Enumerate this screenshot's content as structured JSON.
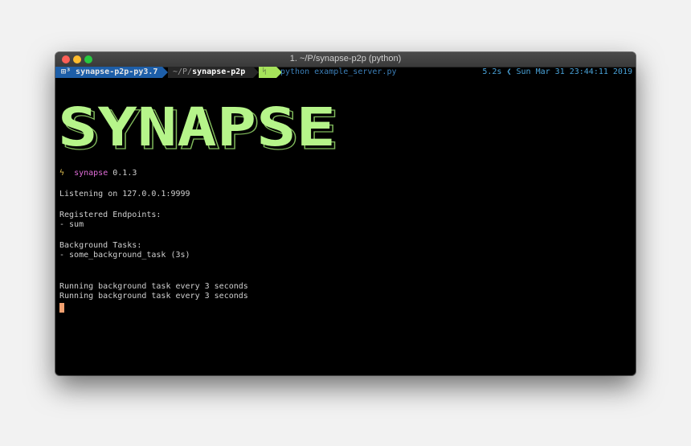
{
  "window": {
    "title": "1. ~/P/synapse-p2p (python)"
  },
  "prompt": {
    "env": "⊞³ synapse-p2p-py3.7",
    "dir_prefix": "~/P/",
    "dir_name": "synapse-p2p",
    "git_icon": "ᛋ",
    "command": "python example_server.py",
    "right": "5.2s ❮ Sun Mar 31 23:44:11 2019"
  },
  "banner": {
    "text": "SYNAPSE"
  },
  "output": {
    "bolt": "ϟ",
    "package_name": "synapse",
    "version": "0.1.3",
    "listening": "Listening on 127.0.0.1:9999",
    "endpoints_header": "Registered Endpoints:",
    "endpoint_1": "- sum",
    "tasks_header": "Background Tasks:",
    "task_1": "- some_background_task (3s)",
    "log_1": "Running background task every 3 seconds",
    "log_2": "Running background task every 3 seconds"
  },
  "colors": {
    "banner_fill": "#b6f58a",
    "banner_shadow": "#7fb85a",
    "prompt_env_bg": "#1d5ea8",
    "git_segment_bg": "#a6e35b",
    "cursor": "#f0a070"
  }
}
